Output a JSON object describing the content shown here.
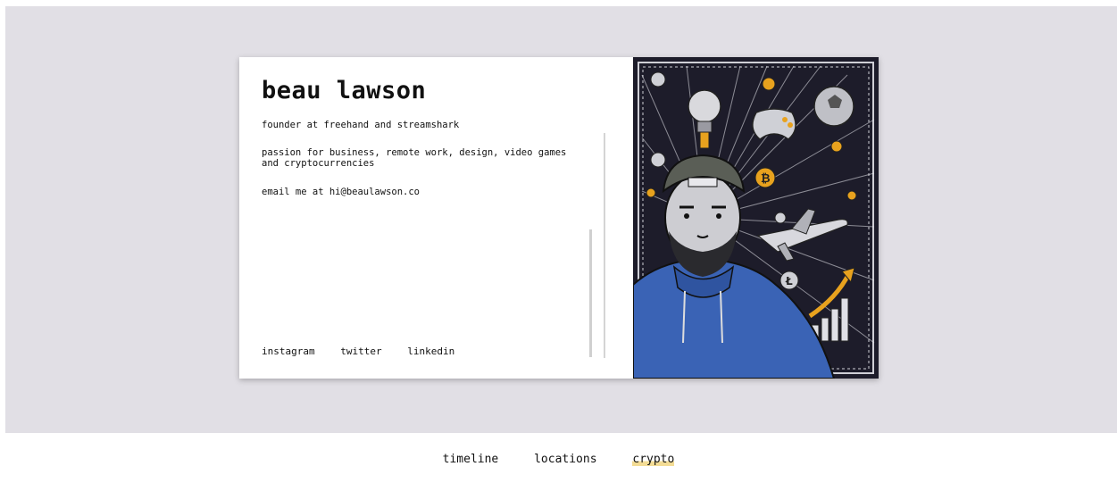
{
  "profile": {
    "name": "beau lawson",
    "line1": "founder at freehand and streamshark",
    "line2": "passion for business, remote work, design, video games and cryptocurrencies",
    "line3": "email me at hi@beaulawson.co"
  },
  "socials": {
    "instagram": "instagram",
    "twitter": "twitter",
    "linkedin": "linkedin"
  },
  "nav": {
    "timeline": "timeline",
    "locations": "locations",
    "crypto": "crypto",
    "active": "crypto"
  },
  "colors": {
    "stage_bg": "#e1dfe5",
    "card_bg": "#ffffff",
    "art_bg": "#1d1c2a",
    "hoodie": "#3a63b5",
    "coin": "#e8a21e",
    "highlight": "#f3dc95"
  },
  "illustration": {
    "subject": "portrait-illustration",
    "icons": [
      "lightbulb-icon",
      "gamepad-icon",
      "soccer-ball-icon",
      "bitcoin-icon",
      "airplane-icon",
      "bar-chart-icon",
      "litecoin-icon"
    ]
  }
}
